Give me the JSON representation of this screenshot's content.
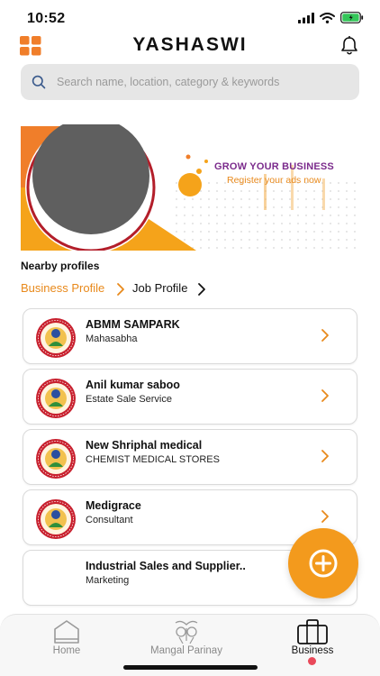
{
  "status_bar": {
    "time": "10:52"
  },
  "header": {
    "title": "YASHASWI"
  },
  "search": {
    "placeholder": "Search name, location, category & keywords"
  },
  "banner": {
    "headline": "GROW YOUR BUSINESS",
    "subline": "Register your ads now"
  },
  "nearby": {
    "title": "Nearby profiles",
    "tabs": [
      {
        "label": "Business Profile",
        "active": true
      },
      {
        "label": "Job Profile",
        "active": false
      }
    ]
  },
  "profiles": [
    {
      "name": "ABMM SAMPARK",
      "category": "Mahasabha",
      "has_logo": true
    },
    {
      "name": "Anil kumar saboo",
      "category": "Estate Sale Service",
      "has_logo": true
    },
    {
      "name": "New Shriphal medical",
      "category": "CHEMIST MEDICAL STORES",
      "has_logo": true
    },
    {
      "name": "Medigrace",
      "category": "Consultant",
      "has_logo": true
    },
    {
      "name": "Industrial Sales and Supplier..",
      "category": "Marketing",
      "has_logo": false
    }
  ],
  "bottom_nav": {
    "items": [
      {
        "label": "Home",
        "icon": "home-icon",
        "active": false
      },
      {
        "label": "Mangal Parinay",
        "icon": "wedding-icon",
        "active": false
      },
      {
        "label": "Business",
        "icon": "briefcase-icon",
        "active": true
      }
    ]
  },
  "colors": {
    "accent": "#f39a1d",
    "banner_headline": "#7b2b8c",
    "active_dot": "#e9495a",
    "search_bg": "#e6e6e6"
  }
}
